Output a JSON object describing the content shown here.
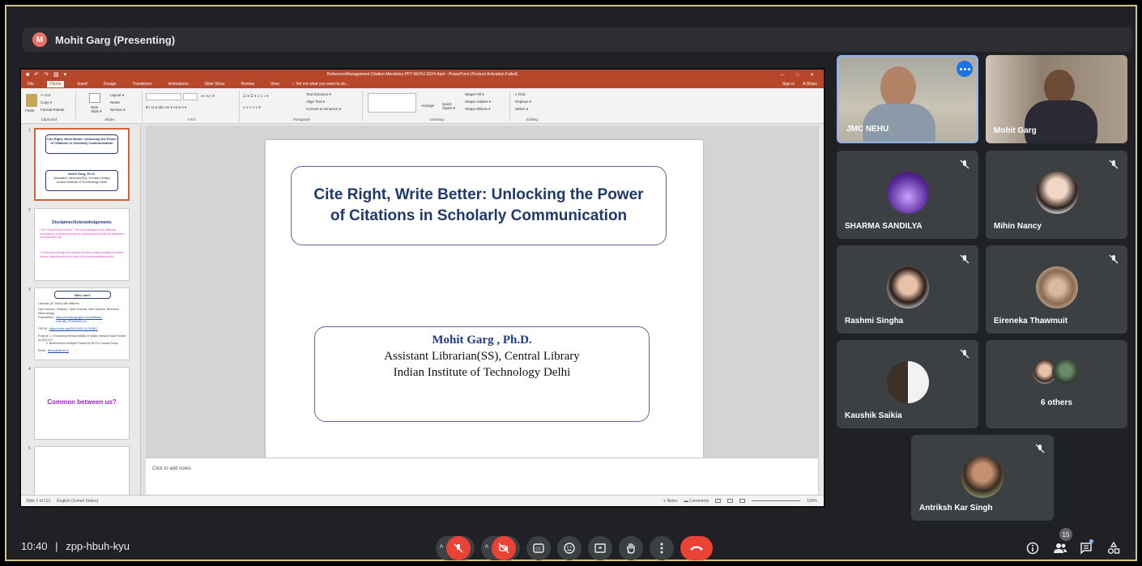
{
  "meeting": {
    "presenter_initial": "M",
    "presenter_label": "Mohit Garg (Presenting)",
    "time": "10:40",
    "separator": "|",
    "code": "zpp-hbuh-kyu",
    "people_count": "15"
  },
  "ppt": {
    "window_title": "ReferenceManagement-Citation-Mendeley-PPT-NEHU-2024-April - PowerPoint (Product Activation Failed)",
    "quick_access": [
      "■",
      "↶",
      "↷",
      "▧",
      "▾"
    ],
    "window_controls": [
      "—",
      "□",
      "✕"
    ],
    "tabs": [
      "File",
      "Home",
      "Insert",
      "Design",
      "Transitions",
      "Animations",
      "Slide Show",
      "Review",
      "View"
    ],
    "tell_me": "⌕ Tell me what you want to do...",
    "signin": "Sign in",
    "share": "Α Share",
    "ribbon": {
      "clipboard": {
        "label": "Clipboard",
        "paste": "Paste",
        "cut": "✂ Cut",
        "copy": "Copy ▾",
        "format_painter": "Format Painter"
      },
      "slides": {
        "label": "Slides",
        "new_slide": "New Slide ▾",
        "layout": "Layout ▾",
        "reset": "Reset",
        "section": "Section ▾"
      },
      "font": {
        "label": "Font",
        "controls": "B  I  U  S  abc  AV ▾  Aa ▾  A ▾",
        "size_controls": "A˄  A˅  A̸"
      },
      "paragraph": {
        "label": "Paragraph",
        "row1": "☰ ▾  ☰ ▾  ≡  ≡  ↕ ▾",
        "row2": "≡  ≡  ≡  ≡  ≡ ▾",
        "text_direction": "Text Direction ▾",
        "align_text": "Align Text ▾",
        "smartart": "Convert to SmartArt ▾"
      },
      "drawing": {
        "label": "Drawing",
        "arrange": "Arrange",
        "quick_styles": "Quick Styles ▾",
        "shape_fill": "Shape Fill ▾",
        "shape_outline": "Shape Outline ▾",
        "shape_effects": "Shape Effects ▾"
      },
      "editing": {
        "label": "Editing",
        "find": "⌕ Find",
        "replace": "Replace ▾",
        "select": "Select ▾"
      }
    },
    "thumbnails": [
      {
        "num": "1",
        "title": "Cite Right, Write Better: Unlocking the Power of Citations in Scholarly Communication",
        "author": "Mohit Garg, Ph.D.",
        "aff1": "Assistant Librarian(SS), Central Library",
        "aff2": "Indian Institute of Technology Delhi"
      },
      {
        "num": "2",
        "title": "Disclaimer/Acknowledgements",
        "p1": "• The PowerPoint Content : The deck designed from different resources to help the learners to understand the tools for academic and research use.",
        "p2": "• I duly acknowledge the authors and the publicly created providers whose materials are been used in the presentation/content."
      },
      {
        "num": "3",
        "title": "Who I am?",
        "l1": "Librarian (IIT Delhi) with different",
        "l2": "Open Access, Software, Open Science, Web Science, Research Methodology",
        "l3": "Publications:",
        "link1": "https://scholar.google.co.in/citations?user=8E_PKbfdJ6Ihl=en",
        "l4": "ORCID:",
        "link2": "https://orcid.org/0000-0002-3176-5817",
        "l5": "Projects: 1. Enhancing Interoperability of Indian research data Funded by DBT-ICT",
        "l6": "2. Bibliometrics Analysis Funded by BI Pvt Consult Group",
        "l7": "Email:",
        "link3": "library@iitd.ac.in"
      },
      {
        "num": "4",
        "title": "Common between us?"
      },
      {
        "num": "5"
      }
    ],
    "slide": {
      "title": "Cite Right, Write Better: Unlocking the Power of Citations in Scholarly Communication",
      "author": "Mohit Garg , Ph.D.",
      "aff1": "Assistant Librarian(SS), Central Library",
      "aff2": "Indian Institute of Technology Delhi"
    },
    "notes_placeholder": "Click to add notes",
    "status": {
      "slide": "Slide 1 of 112",
      "lang": "English (United States)",
      "notes": "≡ Notes",
      "comments": "▬ Comments",
      "zoom": "100%"
    }
  },
  "participants": [
    {
      "name": "JMC NEHU"
    },
    {
      "name": "Mohit Garg"
    },
    {
      "name": "SHARMA SANDILYA"
    },
    {
      "name": "Mihin Nancy"
    },
    {
      "name": "Rashmi Singha"
    },
    {
      "name": "Eireneka Thawmuit"
    },
    {
      "name": "Kaushik Saikia"
    },
    {
      "name": "6 others"
    },
    {
      "name": "Antriksh Kar Singh"
    }
  ],
  "colors": {
    "meet_bg": "#202124",
    "tile_bg": "#3c4043",
    "ppt_accent": "#b7472a",
    "end_call": "#ea4335",
    "speaking_border": "#8ab4f8"
  }
}
